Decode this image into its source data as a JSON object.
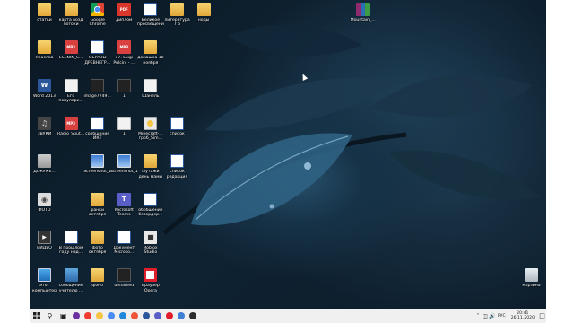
{
  "desktop_icons": [
    {
      "label": "статьи",
      "icon": "folder",
      "col": 0,
      "row": 0
    },
    {
      "label": "карта возд потоки",
      "icon": "folder-pic",
      "col": 1,
      "row": 0
    },
    {
      "label": "Google Chrome",
      "icon": "chrome",
      "col": 2,
      "row": 0
    },
    {
      "label": "диплом",
      "icon": "pdf",
      "col": 3,
      "row": 0
    },
    {
      "label": "Великое просвещени...",
      "icon": "word",
      "col": 4,
      "row": 0
    },
    {
      "label": "литература 7 б",
      "icon": "folder-pic",
      "col": 5,
      "row": 0
    },
    {
      "label": "ноды",
      "icon": "folder",
      "col": 6,
      "row": 0
    },
    {
      "label": "Mountain_...",
      "icon": "rar",
      "col": 12,
      "row": 0
    },
    {
      "label": "Ярослав",
      "icon": "folder",
      "col": 0,
      "row": 1
    },
    {
      "label": "ESENIN_S...",
      "icon": "mp3",
      "col": 1,
      "row": 1
    },
    {
      "label": "ОБРАЗЫ ДРЕВНЕГР...",
      "icon": "word",
      "col": 2,
      "row": 1
    },
    {
      "label": "17. Luigi Pulcini - ...",
      "icon": "mp3",
      "col": 3,
      "row": 1
    },
    {
      "label": "домашка 10 ноября",
      "icon": "folder",
      "col": 4,
      "row": 1
    },
    {
      "label": "Word 2013",
      "icon": "word-doc",
      "col": 0,
      "row": 2
    },
    {
      "label": "Его популяри...",
      "icon": "white",
      "col": 1,
      "row": 2
    },
    {
      "label": "image7749...",
      "icon": "black",
      "col": 2,
      "row": 2
    },
    {
      "label": "1",
      "icon": "black",
      "col": 3,
      "row": 2
    },
    {
      "label": "Шанель",
      "icon": "white",
      "col": 4,
      "row": 2
    },
    {
      "label": "ЗВУКИ",
      "icon": "speaker",
      "col": 0,
      "row": 3
    },
    {
      "label": "Radio_Sput...",
      "icon": "mp3",
      "col": 1,
      "row": 3
    },
    {
      "label": "сообщение ИКТ",
      "icon": "word",
      "col": 2,
      "row": 3
    },
    {
      "label": "1",
      "icon": "white",
      "col": 3,
      "row": 3
    },
    {
      "label": "Minecraft-... гроб_Sim...",
      "icon": "mine",
      "col": 4,
      "row": 3
    },
    {
      "label": "список",
      "icon": "word",
      "col": 5,
      "row": 3
    },
    {
      "label": "ДОКУМЕ...",
      "icon": "docs",
      "col": 0,
      "row": 4
    },
    {
      "label": "Screenshot_2",
      "icon": "screen",
      "col": 2,
      "row": 4
    },
    {
      "label": "Screenshot_1",
      "icon": "screen",
      "col": 3,
      "row": 4
    },
    {
      "label": "футажи день мамы",
      "icon": "folder-pic",
      "col": 4,
      "row": 4
    },
    {
      "label": "список редакция",
      "icon": "word",
      "col": 5,
      "row": 4
    },
    {
      "label": "ФОТО",
      "icon": "camera",
      "col": 0,
      "row": 5
    },
    {
      "label": "ранки октября",
      "icon": "folder",
      "col": 2,
      "row": 5
    },
    {
      "label": "Microsoft Teams",
      "icon": "teams",
      "col": 3,
      "row": 5
    },
    {
      "label": "обобщение безордер...",
      "icon": "word",
      "col": 4,
      "row": 5
    },
    {
      "label": "ВИДЕО",
      "icon": "film",
      "col": 0,
      "row": 6
    },
    {
      "label": "В прошлом году над...",
      "icon": "word",
      "col": 1,
      "row": 6
    },
    {
      "label": "фото октября",
      "icon": "folder-pic",
      "col": 2,
      "row": 6
    },
    {
      "label": "Документ Microso...",
      "icon": "word",
      "col": 3,
      "row": 6
    },
    {
      "label": "Roblox Studio",
      "icon": "roblox",
      "col": 4,
      "row": 6
    },
    {
      "label": "Этот компьютер",
      "icon": "pc",
      "col": 0,
      "row": 7
    },
    {
      "label": "сообщение учителю ...",
      "icon": "users",
      "col": 1,
      "row": 7
    },
    {
      "label": "фоно",
      "icon": "folder-pic",
      "col": 2,
      "row": 7
    },
    {
      "label": "unnamed",
      "icon": "black",
      "col": 3,
      "row": 7
    },
    {
      "label": "Браузер Opera",
      "icon": "opera",
      "col": 4,
      "row": 7
    },
    {
      "label": "Корзина",
      "icon": "bin",
      "col": 19,
      "row": 7
    }
  ],
  "taskbar": {
    "apps": [
      {
        "name": "cortana",
        "color": "#6b2fa0"
      },
      {
        "name": "yandex",
        "color": "#f23b2f"
      },
      {
        "name": "file-explorer",
        "color": "#f4c542"
      },
      {
        "name": "chrome",
        "color": "#4a8af4"
      },
      {
        "name": "edge",
        "color": "#1f88d8"
      },
      {
        "name": "yandex-browser",
        "color": "#f0553a"
      },
      {
        "name": "word",
        "color": "#2b579a"
      },
      {
        "name": "teams",
        "color": "#5a5fc8"
      },
      {
        "name": "opera",
        "color": "#e11d2b"
      },
      {
        "name": "mail",
        "color": "#3f7fd6"
      },
      {
        "name": "obs",
        "color": "#2c2c2c"
      }
    ],
    "language": "РУС",
    "time": "20:41",
    "date": "26.11.2020"
  }
}
